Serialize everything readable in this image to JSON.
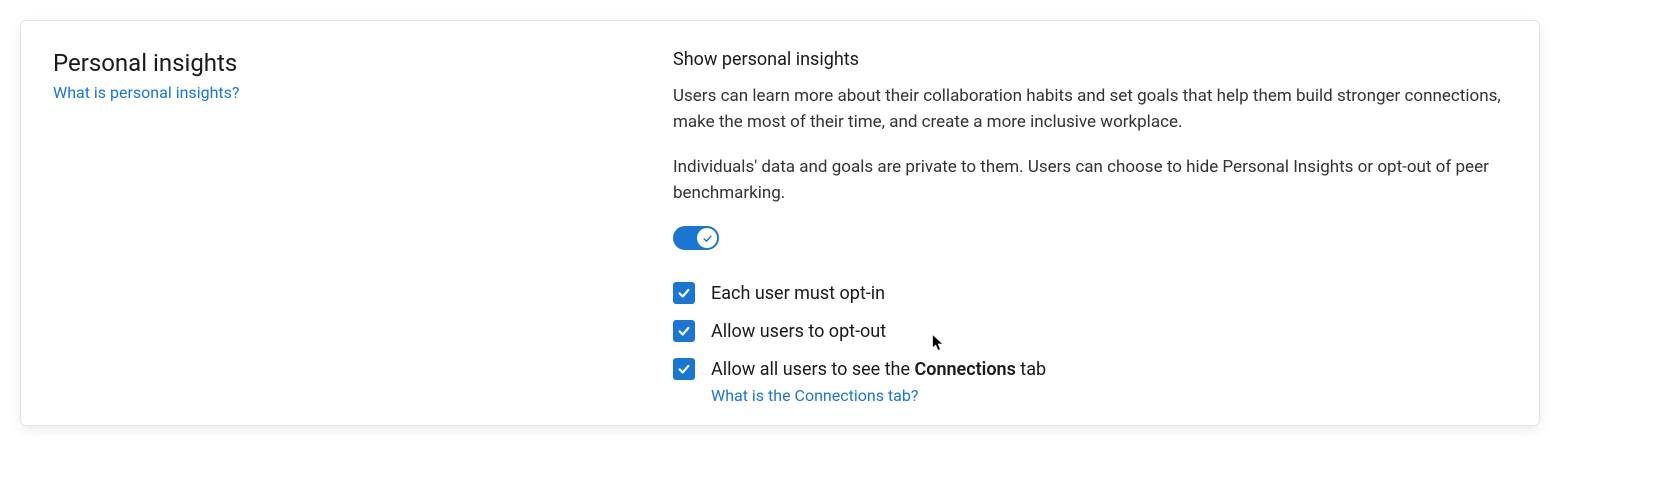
{
  "header": {
    "title": "Personal insights",
    "help_link": "What is personal insights?"
  },
  "settings": {
    "heading": "Show personal insights",
    "description1": "Users can learn more about their collaboration habits and set goals that help them build stronger connections, make the most of their time, and create a more inclusive workplace.",
    "description2": "Individuals' data and goals are private to them. Users can choose to hide Personal Insights or opt-out of peer benchmarking.",
    "toggle_on": true,
    "options": [
      {
        "label": "Each user must opt-in",
        "checked": true
      },
      {
        "label": "Allow users to opt-out",
        "checked": true
      },
      {
        "label_prefix": "Allow all users to see the ",
        "label_bold": "Connections",
        "label_suffix": " tab",
        "checked": true,
        "sub_link": "What is the Connections tab?"
      }
    ]
  }
}
